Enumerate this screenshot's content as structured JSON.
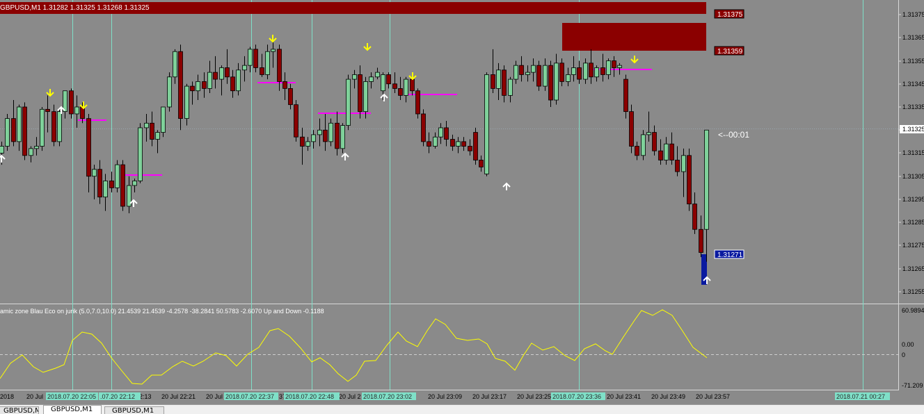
{
  "main_chart": {
    "header": "GBPUSD,M1  1.31282 1.31325 1.31268 1.31325",
    "price_labels": [
      "1.31375",
      "1.31365",
      "1.31355",
      "1.31345",
      "1.31335",
      "1.31325",
      "1.31315",
      "1.31305",
      "1.31295",
      "1.31285",
      "1.31275",
      "1.31265",
      "1.31255"
    ],
    "current_price": "1.31325",
    "zone_labels": {
      "top": "1.31375",
      "upper": "1.31359",
      "lower": "1.31271"
    },
    "countdown": "<--00:01"
  },
  "indicator": {
    "header": "amic zone Blau Eco on jurik (5.0,7.0,10.0) 21.4539 21.4539 -4.2578 -38.2841 50.5783 -2.6070  Up and Down -0.1188",
    "scale_labels": [
      "60.9894",
      "0.00",
      "0",
      "-71.209"
    ]
  },
  "time_axis": {
    "labels": [
      "2018",
      "20 Jul",
      "2:13",
      "20 Jul 22:21",
      "20 Jul",
      "37",
      "20 Jul 2",
      "20 Jul 23:09",
      "20 Jul 23:17",
      "20 Jul 23:25",
      "20 Jul 23:41",
      "20 Jul 23:49",
      "20 Jul 23:57"
    ],
    "highlight_labels": [
      "2018.07.20 22:05",
      ".07.20 22:12",
      "2018.07.20 22:37",
      "2018.07.20 22:48",
      "2018.07.20 23:02",
      "2018.07.20 23:36",
      "2018.07.21 00:27"
    ]
  },
  "tabs": [
    "GBPUSD,M1",
    "GBPUSD,M1",
    "GBPUSD,M1"
  ],
  "colors": {
    "background": "#8a8a8a",
    "bull": "#7fd19a",
    "bear": "#8b0000",
    "zone": "#8b0000",
    "vline": "#7fe0c8",
    "indicator": "#ffff00",
    "magenta": "#ff00ff",
    "up_arrow": "#ffffff",
    "down_arrow": "#ffff00"
  },
  "chart_data": {
    "type": "candlestick",
    "symbol": "GBPUSD",
    "timeframe": "M1",
    "ylim": [
      1.3125,
      1.3138
    ],
    "candles": [
      [
        1.31315,
        1.3132,
        1.3131,
        1.31318
      ],
      [
        1.31318,
        1.31332,
        1.31316,
        1.3133
      ],
      [
        1.3133,
        1.31338,
        1.31318,
        1.3132
      ],
      [
        1.3132,
        1.31336,
        1.31316,
        1.31335
      ],
      [
        1.31335,
        1.31337,
        1.31312,
        1.31314
      ],
      [
        1.31314,
        1.31318,
        1.31311,
        1.31317
      ],
      [
        1.31317,
        1.31322,
        1.31314,
        1.31318
      ],
      [
        1.31318,
        1.31335,
        1.31316,
        1.31334
      ],
      [
        1.31334,
        1.3134,
        1.31324,
        1.31333
      ],
      [
        1.31333,
        1.31336,
        1.31318,
        1.3132
      ],
      [
        1.3132,
        1.31334,
        1.31318,
        1.31333
      ],
      [
        1.31333,
        1.31342,
        1.3133,
        1.31342
      ],
      [
        1.31342,
        1.31343,
        1.3133,
        1.31332
      ],
      [
        1.31332,
        1.3134,
        1.31326,
        1.31335
      ],
      [
        1.31335,
        1.31337,
        1.31328,
        1.3133
      ],
      [
        1.3133,
        1.31332,
        1.31298,
        1.31305
      ],
      [
        1.31305,
        1.3131,
        1.31295,
        1.31308
      ],
      [
        1.31308,
        1.31312,
        1.31293,
        1.31296
      ],
      [
        1.31296,
        1.31306,
        1.3129,
        1.31303
      ],
      [
        1.31303,
        1.31307,
        1.31298,
        1.313
      ],
      [
        1.313,
        1.31312,
        1.31298,
        1.3131
      ],
      [
        1.3131,
        1.31312,
        1.3129,
        1.31292
      ],
      [
        1.31292,
        1.31305,
        1.31289,
        1.31301
      ],
      [
        1.31301,
        1.31304,
        1.31298,
        1.31303
      ],
      [
        1.31303,
        1.31328,
        1.31302,
        1.31326
      ],
      [
        1.31326,
        1.31332,
        1.3132,
        1.31328
      ],
      [
        1.31328,
        1.31333,
        1.31318,
        1.31321
      ],
      [
        1.31321,
        1.31325,
        1.31315,
        1.31324
      ],
      [
        1.31324,
        1.31335,
        1.31322,
        1.31335
      ],
      [
        1.31335,
        1.3135,
        1.31333,
        1.31348
      ],
      [
        1.31348,
        1.3136,
        1.31345,
        1.31359
      ],
      [
        1.31359,
        1.31362,
        1.31325,
        1.3133
      ],
      [
        1.3133,
        1.31345,
        1.31327,
        1.31344
      ],
      [
        1.31344,
        1.31346,
        1.31336,
        1.31342
      ],
      [
        1.31342,
        1.31349,
        1.31338,
        1.31346
      ],
      [
        1.31346,
        1.3135,
        1.31339,
        1.31343
      ],
      [
        1.31343,
        1.31355,
        1.31341,
        1.3135
      ],
      [
        1.3135,
        1.31357,
        1.31343,
        1.31347
      ],
      [
        1.31347,
        1.31353,
        1.3134,
        1.31352
      ],
      [
        1.31352,
        1.3136,
        1.31345,
        1.31348
      ],
      [
        1.31348,
        1.31351,
        1.31339,
        1.31342
      ],
      [
        1.31342,
        1.31354,
        1.3134,
        1.31351
      ],
      [
        1.31351,
        1.31357,
        1.31346,
        1.31353
      ],
      [
        1.31353,
        1.31361,
        1.3135,
        1.3136
      ],
      [
        1.3136,
        1.31362,
        1.3135,
        1.31352
      ],
      [
        1.31352,
        1.31358,
        1.31348,
        1.31349
      ],
      [
        1.31349,
        1.31362,
        1.31347,
        1.31359
      ],
      [
        1.31359,
        1.31363,
        1.31352,
        1.3136
      ],
      [
        1.3136,
        1.31362,
        1.31342,
        1.31346
      ],
      [
        1.31346,
        1.3135,
        1.31338,
        1.31343
      ],
      [
        1.31343,
        1.31345,
        1.31334,
        1.31336
      ],
      [
        1.31336,
        1.31338,
        1.3132,
        1.31322
      ],
      [
        1.31322,
        1.31326,
        1.3131,
        1.31318
      ],
      [
        1.31318,
        1.31322,
        1.31316,
        1.3132
      ],
      [
        1.3132,
        1.31325,
        1.31317,
        1.31323
      ],
      [
        1.31323,
        1.3133,
        1.31318,
        1.31325
      ],
      [
        1.31325,
        1.31332,
        1.31316,
        1.3132
      ],
      [
        1.3132,
        1.3133,
        1.31318,
        1.31328
      ],
      [
        1.31328,
        1.31333,
        1.31314,
        1.31317
      ],
      [
        1.31317,
        1.31328,
        1.31315,
        1.31327
      ],
      [
        1.31327,
        1.31349,
        1.31325,
        1.31347
      ],
      [
        1.31347,
        1.31351,
        1.31343,
        1.31349
      ],
      [
        1.31349,
        1.31353,
        1.3133,
        1.31333
      ],
      [
        1.31333,
        1.31348,
        1.3133,
        1.31346
      ],
      [
        1.31346,
        1.3135,
        1.31343,
        1.31348
      ],
      [
        1.31348,
        1.31352,
        1.31347,
        1.3135
      ],
      [
        1.31342,
        1.3135,
        1.31338,
        1.31349
      ],
      [
        1.31349,
        1.3135,
        1.31343,
        1.31345
      ],
      [
        1.31345,
        1.3135,
        1.31341,
        1.31343
      ],
      [
        1.31343,
        1.31348,
        1.31338,
        1.3134
      ],
      [
        1.3134,
        1.31348,
        1.31337,
        1.31347
      ],
      [
        1.31347,
        1.3135,
        1.3134,
        1.31342
      ],
      [
        1.31342,
        1.31343,
        1.3133,
        1.31332
      ],
      [
        1.31332,
        1.31334,
        1.31318,
        1.3132
      ],
      [
        1.3132,
        1.31324,
        1.31315,
        1.31318
      ],
      [
        1.31318,
        1.31324,
        1.31317,
        1.31322
      ],
      [
        1.31322,
        1.31328,
        1.31319,
        1.31326
      ],
      [
        1.31326,
        1.31329,
        1.31318,
        1.31321
      ],
      [
        1.31321,
        1.31323,
        1.31316,
        1.31318
      ],
      [
        1.31318,
        1.31322,
        1.31315,
        1.3132
      ],
      [
        1.3132,
        1.31322,
        1.31316,
        1.31318
      ],
      [
        1.31318,
        1.31321,
        1.31314,
        1.31316
      ],
      [
        1.31324,
        1.31326,
        1.3131,
        1.31312
      ],
      [
        1.31312,
        1.31314,
        1.31307,
        1.31309
      ],
      [
        1.31306,
        1.3135,
        1.31305,
        1.31349
      ],
      [
        1.31349,
        1.3136,
        1.31341,
        1.31343
      ],
      [
        1.31343,
        1.31354,
        1.31338,
        1.31351
      ],
      [
        1.31351,
        1.31353,
        1.31337,
        1.3134
      ],
      [
        1.3134,
        1.31348,
        1.31337,
        1.31347
      ],
      [
        1.31347,
        1.31355,
        1.31345,
        1.31353
      ],
      [
        1.31353,
        1.31357,
        1.31346,
        1.31349
      ],
      [
        1.31349,
        1.31353,
        1.31346,
        1.3135
      ],
      [
        1.3135,
        1.31356,
        1.31346,
        1.31353
      ],
      [
        1.31353,
        1.31355,
        1.31342,
        1.31344
      ],
      [
        1.31344,
        1.31356,
        1.31342,
        1.31353
      ],
      [
        1.31353,
        1.31355,
        1.31335,
        1.31338
      ],
      [
        1.31338,
        1.31358,
        1.31336,
        1.31354
      ],
      [
        1.31354,
        1.31356,
        1.31344,
        1.31346
      ],
      [
        1.31346,
        1.31352,
        1.31344,
        1.31349
      ],
      [
        1.31349,
        1.31357,
        1.31346,
        1.31352
      ],
      [
        1.31352,
        1.31355,
        1.31345,
        1.31347
      ],
      [
        1.31347,
        1.31356,
        1.31345,
        1.31354
      ],
      [
        1.31354,
        1.3136,
        1.31345,
        1.31348
      ],
      [
        1.31348,
        1.31353,
        1.31346,
        1.31352
      ],
      [
        1.31352,
        1.31358,
        1.31346,
        1.31349
      ],
      [
        1.31349,
        1.31356,
        1.31347,
        1.31355
      ],
      [
        1.31355,
        1.31357,
        1.31348,
        1.31352
      ],
      [
        1.31352,
        1.31354,
        1.31349,
        1.31353
      ],
      [
        1.31347,
        1.31349,
        1.3133,
        1.31333
      ],
      [
        1.31333,
        1.31336,
        1.31315,
        1.31318
      ],
      [
        1.31318,
        1.3132,
        1.31312,
        1.31314
      ],
      [
        1.31314,
        1.31325,
        1.31312,
        1.31323
      ],
      [
        1.31323,
        1.31333,
        1.3132,
        1.31324
      ],
      [
        1.31324,
        1.31327,
        1.31314,
        1.31316
      ],
      [
        1.31316,
        1.31321,
        1.3131,
        1.31312
      ],
      [
        1.31312,
        1.31322,
        1.3131,
        1.31319
      ],
      [
        1.31319,
        1.31324,
        1.3131,
        1.31312
      ],
      [
        1.31312,
        1.31318,
        1.31305,
        1.31307
      ],
      [
        1.31307,
        1.31317,
        1.31296,
        1.31314
      ],
      [
        1.31314,
        1.31317,
        1.3129,
        1.31293
      ],
      [
        1.31293,
        1.31298,
        1.3128,
        1.31282
      ],
      [
        1.31282,
        1.31288,
        1.3127,
        1.31272
      ],
      [
        1.31282,
        1.31325,
        1.31268,
        1.31325
      ]
    ]
  }
}
